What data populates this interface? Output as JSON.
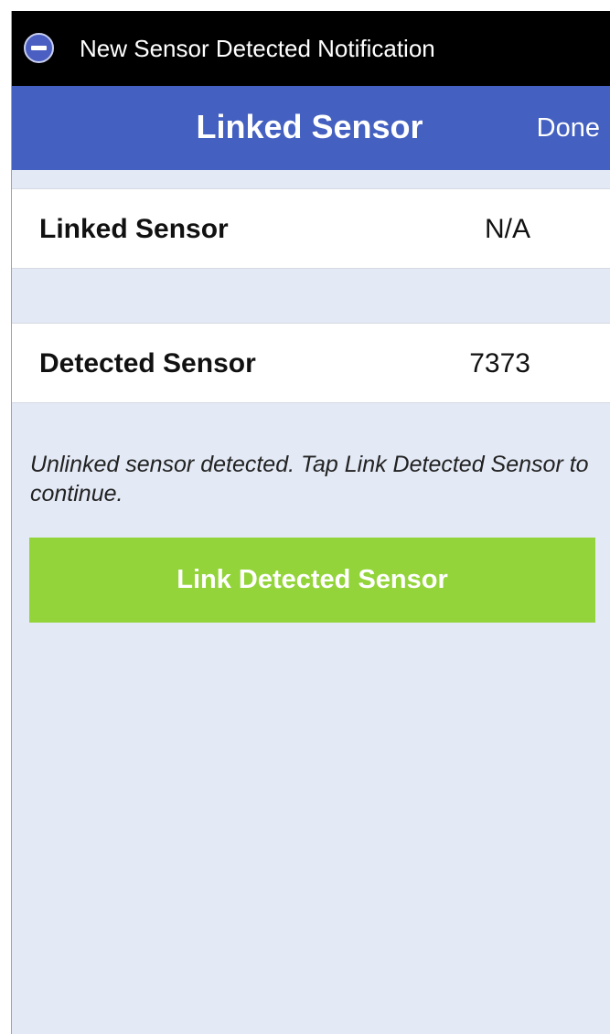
{
  "notification": {
    "icon": "minus-circle-icon",
    "text": "New Sensor Detected Notification"
  },
  "nav": {
    "title": "Linked Sensor",
    "done_label": "Done"
  },
  "rows": [
    {
      "label": "Linked Sensor",
      "value": "N/A"
    },
    {
      "label": "Detected Sensor",
      "value": "7373"
    }
  ],
  "hint": "Unlinked sensor detected. Tap Link Detected Sensor to continue.",
  "link_button": {
    "label": "Link Detected Sensor"
  },
  "colors": {
    "nav_bar": "#4460c0",
    "button": "#93d43a",
    "background": "#e3e9f5",
    "notification_bar": "#000000"
  }
}
